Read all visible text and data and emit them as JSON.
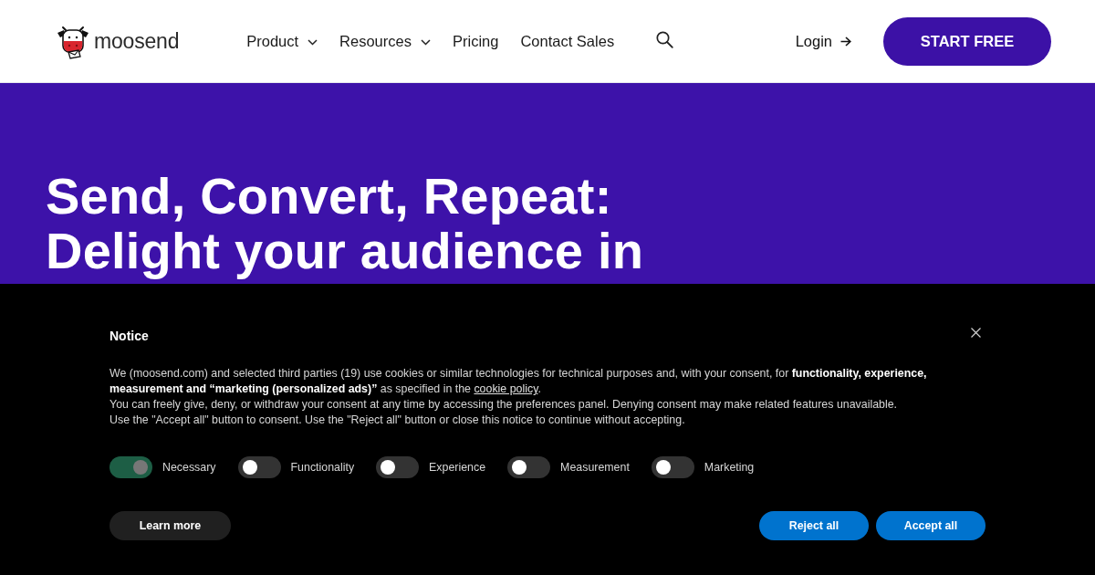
{
  "header": {
    "brand": {
      "name": "moosend"
    },
    "nav": [
      {
        "label": "Product",
        "dropdown": true
      },
      {
        "label": "Resources",
        "dropdown": true
      },
      {
        "label": "Pricing",
        "dropdown": false
      },
      {
        "label": "Contact Sales",
        "dropdown": false
      }
    ],
    "login": {
      "label": "Login"
    },
    "cta": {
      "label": "START FREE"
    }
  },
  "hero": {
    "heading": "Send, Convert, Repeat: Delight your audience in"
  },
  "cookie_notice": {
    "title": "Notice",
    "paragraphs": [
      {
        "text": "We (moosend.com) and selected third parties (19) use cookies or similar technologies for technical purposes and, with your consent, for **functionality, experience, measurement and “marketing (personalized ads)”** as specified in the",
        "link": "cookie policy",
        "end": "."
      },
      {
        "text": "You can freely give, deny, or withdraw your consent at any time by accessing the preferences panel. Denying consent may make related features unavailable."
      },
      {
        "text": "Use the \"Accept all\" button to consent. Use the \"Reject all\" button or close this notice to continue without accepting."
      }
    ],
    "toggles": [
      {
        "label": "Necessary",
        "checked": true,
        "disabled": true
      },
      {
        "label": "Functionality",
        "checked": false,
        "disabled": false
      },
      {
        "label": "Experience",
        "checked": false,
        "disabled": false
      },
      {
        "label": "Measurement",
        "checked": false,
        "disabled": false
      },
      {
        "label": "Marketing",
        "checked": false,
        "disabled": false
      }
    ],
    "buttons": [
      {
        "label": "Learn more",
        "kind": "secondary"
      },
      {
        "label": "Reject all",
        "kind": "primary"
      },
      {
        "label": "Accept all",
        "kind": "primary"
      }
    ]
  }
}
